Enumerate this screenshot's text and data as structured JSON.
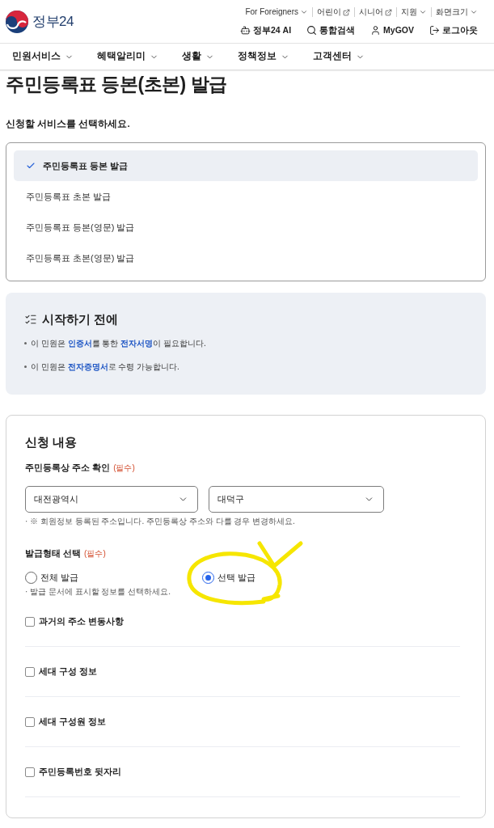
{
  "header": {
    "logo": {
      "text": "정부24"
    },
    "utility_links": [
      {
        "label": "For Foreigners",
        "kind": "dropdown"
      },
      {
        "label": "어린이",
        "kind": "external"
      },
      {
        "label": "시니어",
        "kind": "external"
      },
      {
        "label": "지원",
        "kind": "dropdown"
      },
      {
        "label": "화면크기",
        "kind": "dropdown"
      }
    ],
    "actions": [
      {
        "label": "정부24 AI",
        "kind": "ai"
      },
      {
        "label": "통합검색",
        "kind": "search"
      },
      {
        "label": "MyGOV",
        "kind": "account"
      },
      {
        "label": "로그아웃",
        "kind": "logout"
      }
    ]
  },
  "nav": [
    {
      "label": "민원서비스"
    },
    {
      "label": "혜택알리미"
    },
    {
      "label": "생활"
    },
    {
      "label": "정책정보"
    },
    {
      "label": "고객센터"
    }
  ],
  "page_title": "주민등록표 등본(초본) 발급",
  "service_prompt": "신청할 서비스를 선택하세요.",
  "services": [
    {
      "label": "주민등록표 등본 발급",
      "selected": true
    },
    {
      "label": "주민등록표 초본 발급",
      "selected": false
    },
    {
      "label": "주민등록표 등본(영문) 발급",
      "selected": false
    },
    {
      "label": "주민등록표 초본(영문) 발급",
      "selected": false
    }
  ],
  "notice": {
    "title": "시작하기 전에",
    "items": [
      "이 민원은 **인증서**를 통한 **전자서명**이 필요합니다.",
      "이 민원은 **전자증명서**로 수령 가능합니다."
    ]
  },
  "application": {
    "title": "신청 내용",
    "address": {
      "label": "주민등록상 주소 확인",
      "required": "(필수)",
      "selects": [
        {
          "value": "대전광역시"
        },
        {
          "value": "대덕구"
        }
      ],
      "hint": "· ※ 회원정보 등록된 주소입니다. 주민등록상 주소와 다를 경우 변경하세요."
    },
    "issue_type": {
      "label": "발급형태 선택",
      "required": "(필수)",
      "options": [
        {
          "label": "전체 발급",
          "selected": false
        },
        {
          "label": "선택 발급",
          "selected": true
        }
      ],
      "hint": "· 발급 문서에 표시할 정보를 선택하세요."
    },
    "items": [
      {
        "label": "과거의 주소 변동사항",
        "checked": false
      },
      {
        "label": "세대 구성 정보",
        "checked": false
      },
      {
        "label": "세대 구성원 정보",
        "checked": false
      },
      {
        "label": "주민등록번호 뒷자리",
        "checked": false
      }
    ]
  }
}
